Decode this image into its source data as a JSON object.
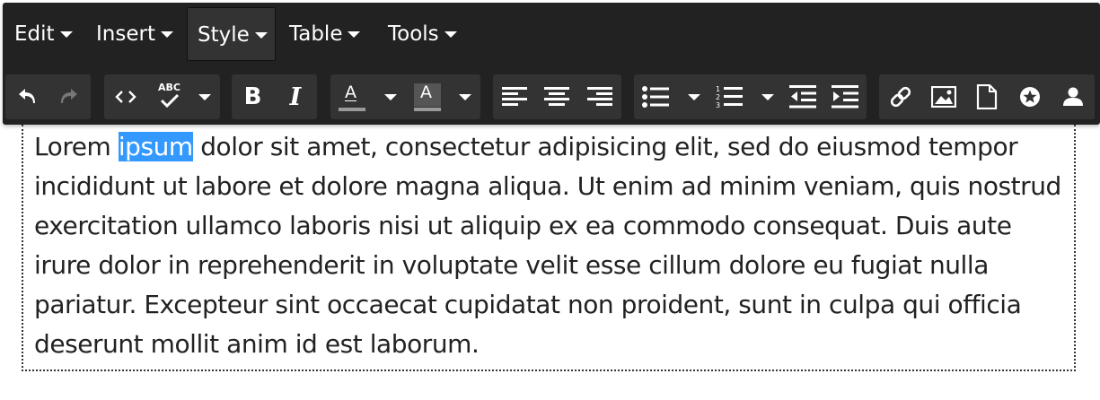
{
  "menubar": {
    "items": [
      {
        "label": "Edit",
        "active": false
      },
      {
        "label": "Insert",
        "active": false
      },
      {
        "label": "Style",
        "active": true
      },
      {
        "label": "Table",
        "active": false
      },
      {
        "label": "Tools",
        "active": false
      }
    ]
  },
  "toolbar": {
    "groups": [
      [
        "undo-icon",
        "redo-icon"
      ],
      [
        "code-icon",
        "spellcheck-icon",
        "chevron-down-icon"
      ],
      [
        "bold-icon",
        "italic-icon"
      ],
      [
        "text-color-icon",
        "chevron-down-icon",
        "background-color-icon",
        "chevron-down-icon"
      ],
      [
        "align-left-icon",
        "align-center-icon",
        "align-right-icon"
      ],
      [
        "bullet-list-icon",
        "chevron-down-icon",
        "numbered-list-icon",
        "chevron-down-icon",
        "outdent-icon",
        "indent-icon"
      ],
      [
        "link-icon",
        "image-icon",
        "file-icon",
        "star-circle-icon",
        "user-icon"
      ]
    ],
    "bold_label": "B",
    "italic_label": "I",
    "font_color_label": "A",
    "bg_color_label": "A",
    "spellcheck_label": "ABC"
  },
  "colors": {
    "toolbar_bg": "#222222",
    "group_bg": "#333333",
    "selection": "#3399ff",
    "text": "#222222"
  },
  "editor": {
    "before_selection": "Lorem ",
    "selected_text": "ipsum",
    "after_selection": " dolor sit amet, consectetur adipisicing elit, sed do eiusmod tempor incididunt ut labore et dolore magna aliqua. Ut enim ad minim veniam, quis nostrud exercitation ullamco laboris nisi ut aliquip ex ea commodo consequat. Duis aute irure dolor in reprehenderit in voluptate velit esse cillum dolore eu fugiat nulla pariatur. Excepteur sint occaecat cupidatat non proident, sunt in culpa qui officia deserunt mollit anim id est laborum."
  }
}
